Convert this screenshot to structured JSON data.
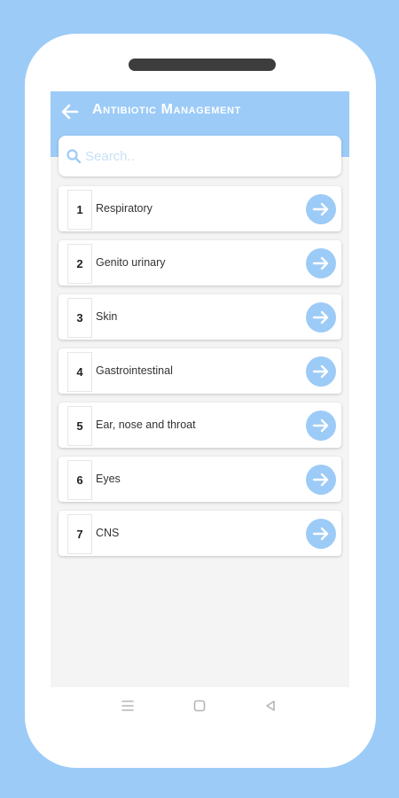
{
  "app": {
    "title": "Antibiotic Management",
    "accent_color": "#9ccbf7"
  },
  "header": {
    "back_icon": "arrow-left-icon"
  },
  "search": {
    "placeholder": "Search..",
    "value": "",
    "icon": "search-icon"
  },
  "categories": [
    {
      "number": "1",
      "label": "Respiratory"
    },
    {
      "number": "2",
      "label": "Genito urinary"
    },
    {
      "number": "3",
      "label": "Skin"
    },
    {
      "number": "4",
      "label": "Gastrointestinal"
    },
    {
      "number": "5",
      "label": "Ear, nose and throat"
    },
    {
      "number": "6",
      "label": "Eyes"
    },
    {
      "number": "7",
      "label": "CNS"
    }
  ],
  "item_action_icon": "arrow-right-icon",
  "system_nav": {
    "menu_icon": "menu-icon",
    "home_icon": "home-square-icon",
    "back_icon": "back-triangle-icon"
  }
}
